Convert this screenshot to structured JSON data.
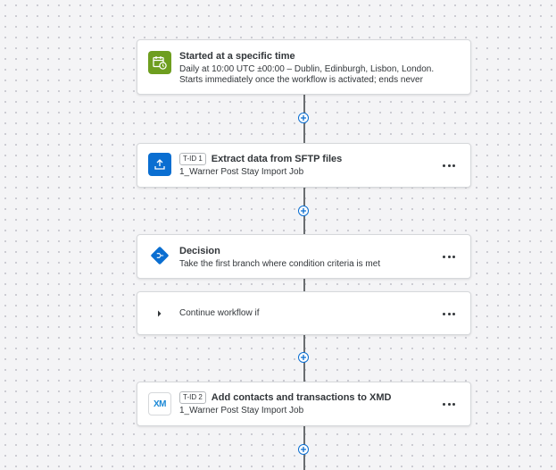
{
  "workflow": {
    "trigger": {
      "title": "Started at a specific time",
      "line1": "Daily at 10:00 UTC ±00:00 – Dublin, Edinburgh, Lisbon, London.",
      "line2": "Starts immediately once the workflow is activated; ends never",
      "icon": "calendar-clock-icon",
      "accent": "#6e9e1f"
    },
    "steps": [
      {
        "tid": "T-ID 1",
        "title": "Extract data from SFTP files",
        "subtitle": "1_Warner Post Stay Import Job",
        "icon": "upload-icon",
        "accent": "#0a6ed1"
      },
      {
        "title": "Decision",
        "subtitle": "Take the first branch where condition criteria is met",
        "icon": "decision-icon",
        "accent": "#0a6ed1"
      },
      {
        "title": "Continue workflow if",
        "icon": "chevron-right-icon"
      },
      {
        "tid": "T-ID 2",
        "title": "Add contacts and transactions to XMD",
        "subtitle": "1_Warner Post Stay Import Job",
        "icon": "xm-logo-icon",
        "logo_text": "XM",
        "accent": "#0a6ed1"
      }
    ],
    "add_step_icon": "plus-circle-icon",
    "more_icon": "more-horizontal-icon"
  }
}
